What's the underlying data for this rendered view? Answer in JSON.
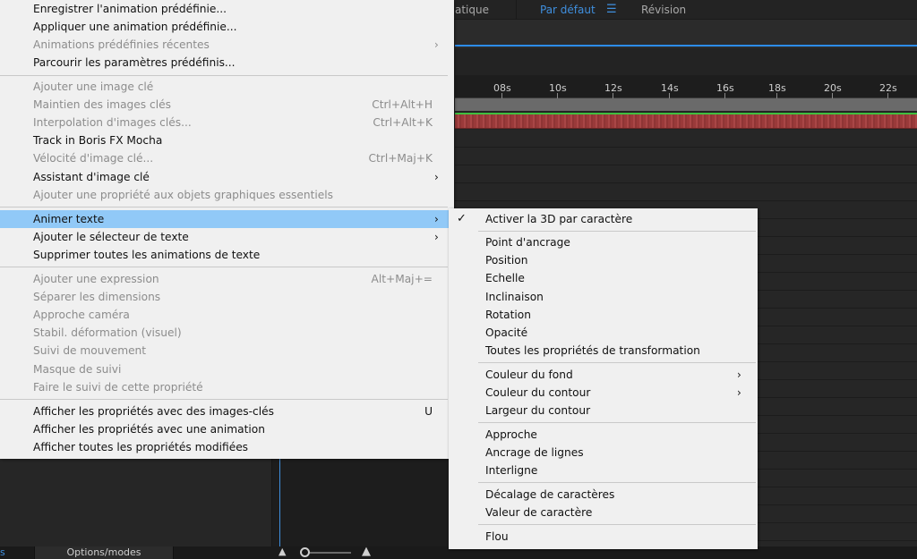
{
  "workspace": {
    "tabs": [
      {
        "label": "atique",
        "active": false
      },
      {
        "label": "Par défaut",
        "active": true
      },
      {
        "label": "Révision",
        "active": false
      }
    ],
    "menu_icon": "hamburger-menu-icon"
  },
  "timeline": {
    "ruler_labels": [
      "08s",
      "10s",
      "12s",
      "14s",
      "16s",
      "18s",
      "20s",
      "22s"
    ]
  },
  "bottom_bar": {
    "left_mark": "s",
    "options_modes": "Options/modes",
    "zoom_out_icon": "mountain-small-icon",
    "zoom_in_icon": "mountain-large-icon"
  },
  "main_menu": {
    "items": [
      {
        "label": "Enregistrer l'animation prédéfinie...",
        "disabled": false
      },
      {
        "label": "Appliquer une animation prédéfinie...",
        "disabled": false
      },
      {
        "label": "Animations prédéfinies récentes",
        "disabled": true,
        "submenu": true
      },
      {
        "label": "Parcourir les paramètres prédéfinis...",
        "disabled": false
      },
      {
        "label": "Ajouter une image clé",
        "disabled": true
      },
      {
        "label": "Maintien des images clés",
        "disabled": true,
        "shortcut": "Ctrl+Alt+H"
      },
      {
        "label": "Interpolation d'images clés...",
        "disabled": true,
        "shortcut": "Ctrl+Alt+K"
      },
      {
        "label": "Track in Boris FX Mocha",
        "disabled": false
      },
      {
        "label": "Vélocité d'image clé...",
        "disabled": true,
        "shortcut": "Ctrl+Maj+K"
      },
      {
        "label": "Assistant d'image clé",
        "disabled": false,
        "submenu": true
      },
      {
        "label": "Ajouter une propriété aux objets graphiques essentiels",
        "disabled": true
      },
      {
        "label": "Animer texte",
        "disabled": false,
        "submenu": true,
        "highlighted": true
      },
      {
        "label": "Ajouter le sélecteur de texte",
        "disabled": false,
        "submenu": true
      },
      {
        "label": "Supprimer toutes les animations de texte",
        "disabled": false
      },
      {
        "label": "Ajouter une expression",
        "disabled": true,
        "shortcut": "Alt+Maj+="
      },
      {
        "label": "Séparer les dimensions",
        "disabled": true
      },
      {
        "label": "Approche caméra",
        "disabled": true
      },
      {
        "label": "Stabil. déformation (visuel)",
        "disabled": true
      },
      {
        "label": "Suivi de mouvement",
        "disabled": true
      },
      {
        "label": "Masque de suivi",
        "disabled": true
      },
      {
        "label": "Faire le suivi de cette propriété",
        "disabled": true
      },
      {
        "label": "Afficher les propriétés avec des images-clés",
        "disabled": false,
        "shortcut": "U"
      },
      {
        "label": "Afficher les propriétés avec une animation",
        "disabled": false
      },
      {
        "label": "Afficher toutes les propriétés modifiées",
        "disabled": false
      }
    ]
  },
  "sub_menu": {
    "items": [
      {
        "label": "Activer la 3D par caractère",
        "checked": true
      },
      {
        "label": "Point d'ancrage"
      },
      {
        "label": "Position"
      },
      {
        "label": "Echelle"
      },
      {
        "label": "Inclinaison"
      },
      {
        "label": "Rotation"
      },
      {
        "label": "Opacité"
      },
      {
        "label": "Toutes les propriétés de transformation"
      },
      {
        "label": "Couleur du fond",
        "submenu": true
      },
      {
        "label": "Couleur du contour",
        "submenu": true
      },
      {
        "label": "Largeur du contour"
      },
      {
        "label": "Approche"
      },
      {
        "label": "Ancrage de lignes"
      },
      {
        "label": "Interligne"
      },
      {
        "label": "Décalage de caractères"
      },
      {
        "label": "Valeur de caractère"
      },
      {
        "label": "Flou"
      }
    ]
  },
  "icons": {
    "submenu_arrow": "chevron-right-icon",
    "check": "check-icon"
  },
  "colors": {
    "menu_bg": "#f0f0f0",
    "highlight": "#91c9f7",
    "accent": "#3f8fde",
    "disabled_text": "#8c8c8c"
  }
}
